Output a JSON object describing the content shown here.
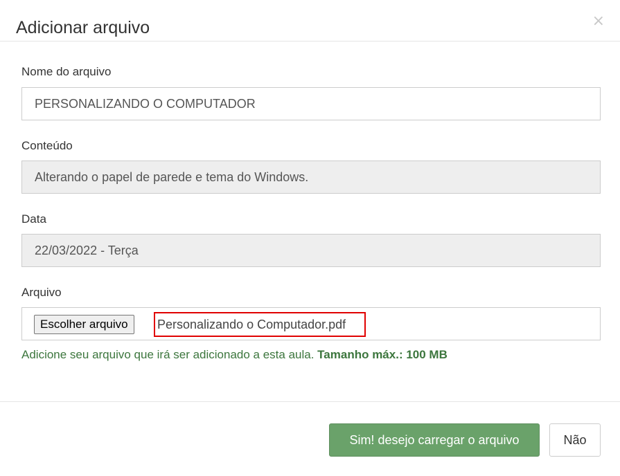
{
  "modal": {
    "title": "Adicionar arquivo",
    "close_symbol": "×"
  },
  "form": {
    "name_label": "Nome do arquivo",
    "name_value": "PERSONALIZANDO O COMPUTADOR",
    "content_label": "Conteúdo",
    "content_value": "Alterando o papel de parede e tema do Windows.",
    "date_label": "Data",
    "date_value": "22/03/2022 - Terça",
    "file_label": "Arquivo",
    "file_button": "Escolher arquivo",
    "file_name": "Personalizando o Computador.pdf",
    "help_text": "Adicione seu arquivo que irá ser adicionado a esta aula. ",
    "help_strong": "Tamanho máx.: 100 MB"
  },
  "footer": {
    "confirm_label": "Sim! desejo carregar o arquivo",
    "cancel_label": "Não"
  },
  "colors": {
    "confirm_button": "#6aa26a",
    "help_text": "#3c763d",
    "highlight_border": "#e00000"
  }
}
